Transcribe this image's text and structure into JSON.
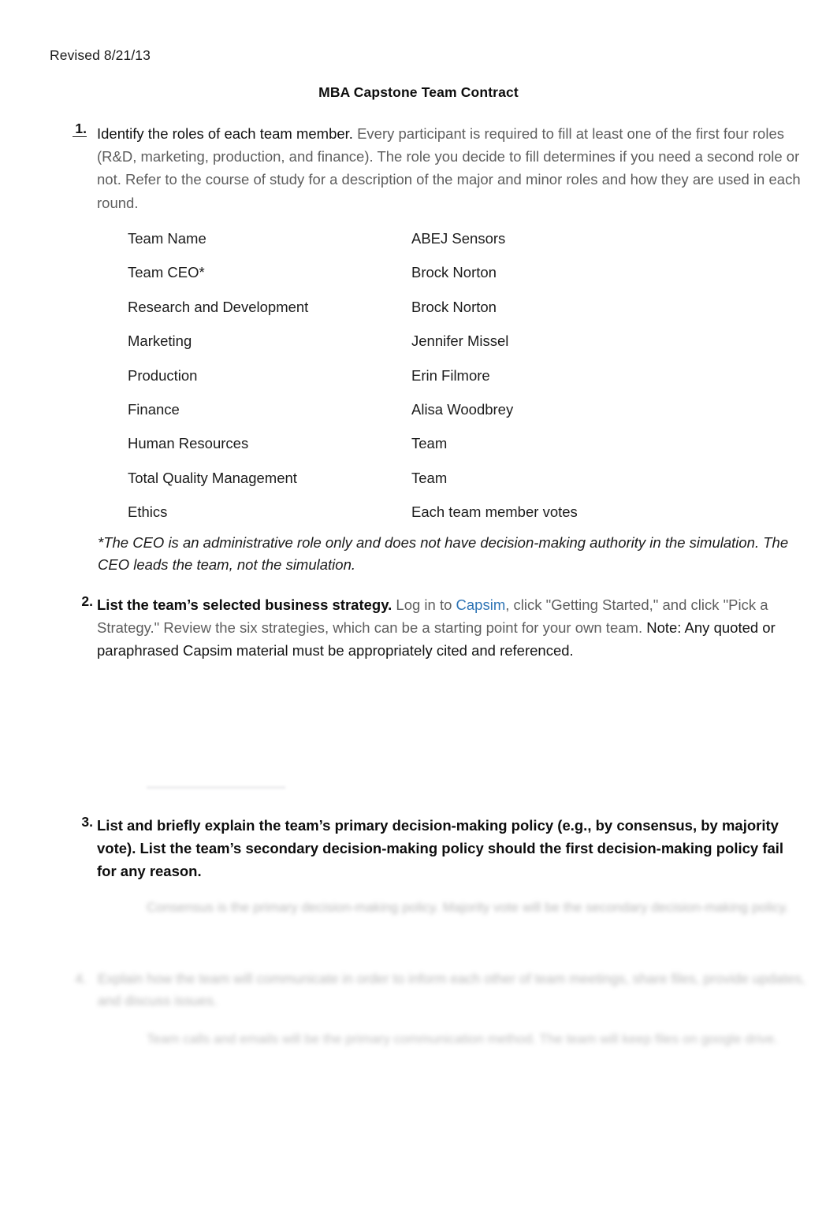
{
  "header": {
    "revised": "Revised 8/21/13",
    "title": "MBA Capstone Team Contract"
  },
  "items": [
    {
      "number": "1.",
      "lead": "Identify the roles of each team member.",
      "rest": "  Every participant is required to fill at least one of the first four roles (R&D, marketing, production, and finance). The role you decide to fill determines if you need a second role or not. Refer to the course of study for a description of the major and minor roles and how they are used in each round."
    },
    {
      "number": "2.",
      "lead": "List the team’s selected business strategy.",
      "rest_a": "  Log in to ",
      "link": "Capsim",
      "rest_b": ", click \"Getting Started,\" and click \"Pick a Strategy.\" Review the six strategies, which can be a starting point for your own team.  ",
      "rest_c": "Note: Any quoted or paraphrased Capsim material must be appropriately cited and referenced."
    },
    {
      "number": "3.",
      "lead": "List and briefly explain the team’s primary decision-making policy (e.g., by consensus, by majority vote).  List the team’s secondary decision-making policy should the first decision-making policy fail for any reason."
    }
  ],
  "roles_table": {
    "rows": [
      {
        "role": "Team Name",
        "person": "ABEJ Sensors"
      },
      {
        "role": "Team CEO*",
        "person": "Brock Norton"
      },
      {
        "role": "Research and Development",
        "person": "Brock Norton"
      },
      {
        "role": "Marketing",
        "person": "Jennifer Missel"
      },
      {
        "role": "Production",
        "person": "Erin Filmore"
      },
      {
        "role": "Finance",
        "person": "Alisa Woodbrey"
      },
      {
        "role": "Human Resources",
        "person": "Team"
      },
      {
        "role": "Total Quality Management",
        "person": "Team"
      },
      {
        "role": "Ethics",
        "person": "Each team member votes"
      }
    ]
  },
  "ceo_note": "*The CEO is an administrative role only and does not have decision-making authority in the simulation. The CEO leads the team, not the simulation.",
  "redacted": {
    "answer_3": "Consensus is the primary decision-making policy. Majority vote will be the secondary decision-making policy.",
    "item_4_number": "4.",
    "item_4": "Explain how the team will communicate in order to inform each other of team meetings, share files, provide updates, and discuss issues.",
    "answer_4": "Team calls and emails will be the primary communication method.  The team will keep files on google drive."
  }
}
